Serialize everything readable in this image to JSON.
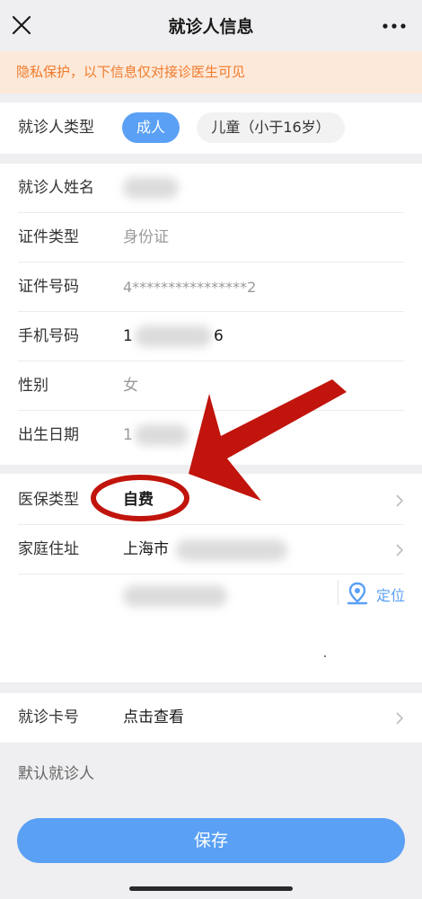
{
  "nav": {
    "title": "就诊人信息"
  },
  "notice": "隐私保护，以下信息仅对接诊医生可见",
  "patient_type": {
    "label": "就诊人类型",
    "options": [
      "成人",
      "儿童（小于16岁）"
    ],
    "selected": "成人"
  },
  "fields": {
    "name": {
      "label": "就诊人姓名"
    },
    "id_type": {
      "label": "证件类型",
      "value": "身份证"
    },
    "id_number": {
      "label": "证件号码",
      "value": "4****************2"
    },
    "phone": {
      "label": "手机号码",
      "value_start": "1",
      "value_end": "6"
    },
    "gender": {
      "label": "性别",
      "value": "女"
    },
    "birth": {
      "label": "出生日期",
      "value_start": "1"
    },
    "insurance": {
      "label": "医保类型",
      "value": "自费"
    },
    "address": {
      "label": "家庭住址",
      "value": "上海市"
    },
    "locate": {
      "label": "定位"
    },
    "card": {
      "label": "就诊卡号",
      "value": "点击查看"
    },
    "default": {
      "label": "默认就诊人"
    }
  },
  "save_label": "保存",
  "colors": {
    "accent": "#5aa0f5",
    "notice_text": "#f07a2c",
    "notice_bg": "#fde9d9",
    "annotation_red": "#c0140c"
  }
}
